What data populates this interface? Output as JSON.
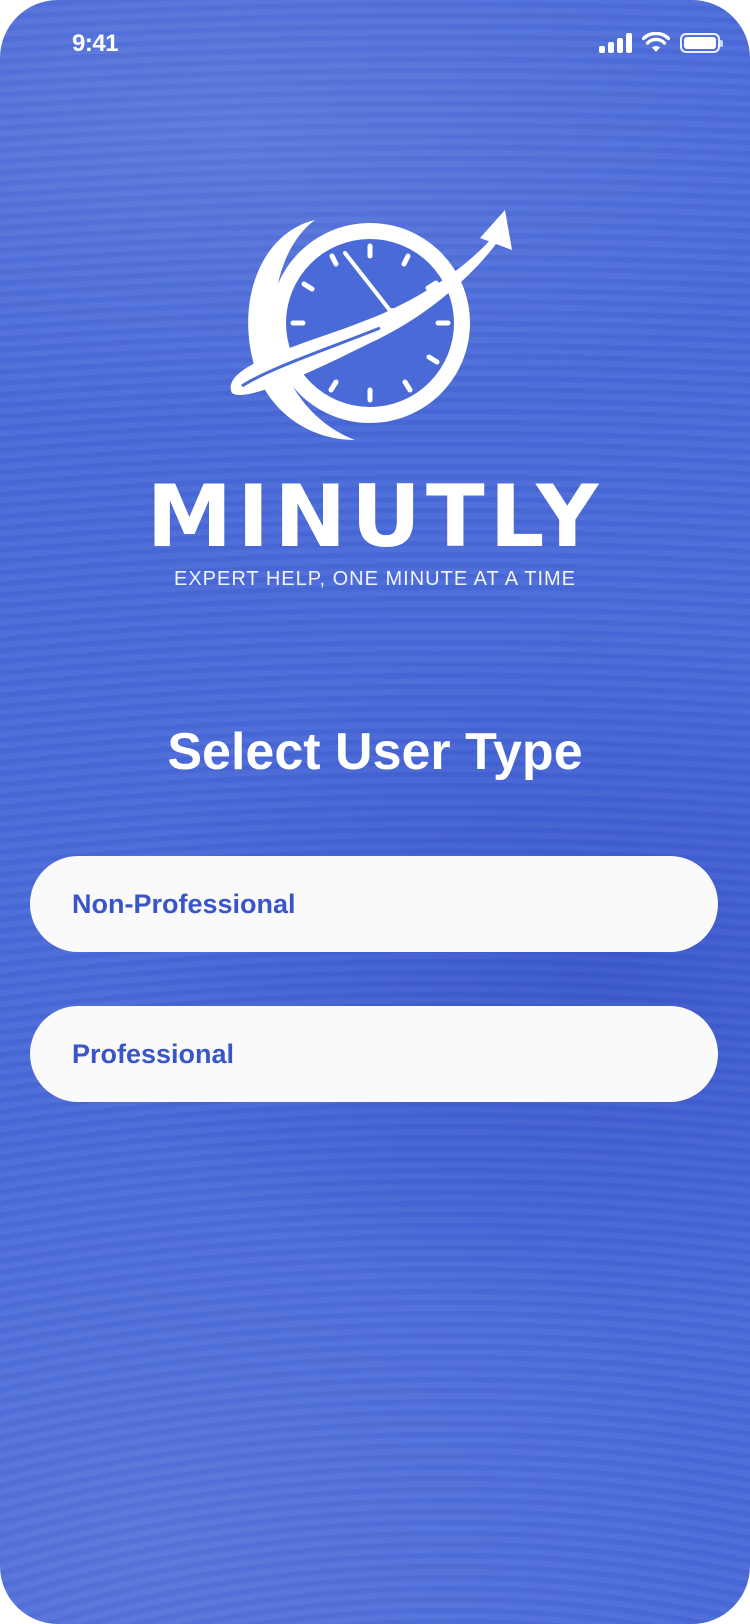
{
  "status_bar": {
    "time": "9:41",
    "icons": [
      "signal-icon",
      "wifi-icon",
      "battery-icon"
    ]
  },
  "brand": {
    "name": "MINUTLY",
    "tagline": "EXPERT HELP, ONE MINUTE AT A TIME",
    "logo_icon": "clock-globe-arrow-logo"
  },
  "page": {
    "title": "Select User Type"
  },
  "options": [
    {
      "label": "Non-Professional"
    },
    {
      "label": "Professional"
    }
  ],
  "colors": {
    "background": "#4a6ad8",
    "button_background": "#fafafa",
    "button_text": "#3a55c8",
    "text": "#ffffff"
  }
}
